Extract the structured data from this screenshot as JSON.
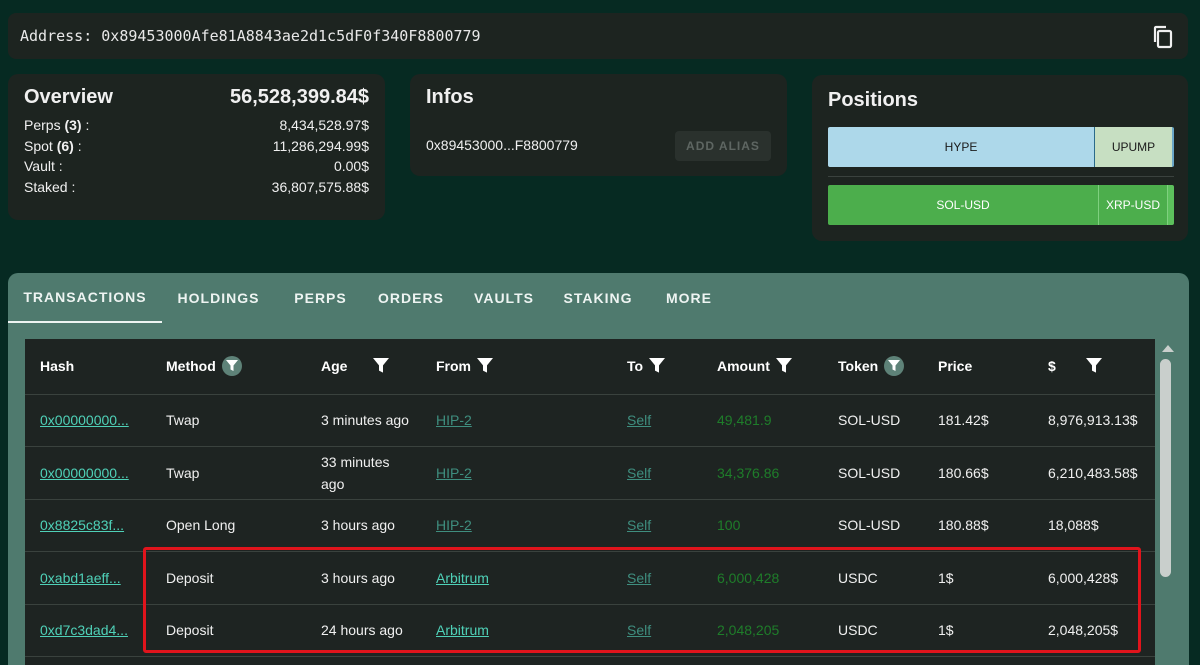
{
  "address_bar": {
    "label": "Address: 0x89453000Afe81A8843ae2d1c5dF0f340F8800779",
    "copy_icon": "copy-icon"
  },
  "overview": {
    "title": "Overview",
    "total": "56,528,399.84$",
    "rows": [
      {
        "label_pre": "Perps ",
        "count": "(3)",
        "label_post": " :",
        "value": "8,434,528.97$"
      },
      {
        "label_pre": "Spot ",
        "count": "(6)",
        "label_post": " :",
        "value": "11,286,294.99$"
      },
      {
        "label_pre": "Vault :",
        "count": "",
        "label_post": "",
        "value": "0.00$"
      },
      {
        "label_pre": "Staked :",
        "count": "",
        "label_post": "",
        "value": "36,807,575.88$"
      }
    ]
  },
  "infos": {
    "title": "Infos",
    "address_short": "0x89453000...F8800779",
    "alias_button": "ADD ALIAS"
  },
  "positions": {
    "title": "Positions",
    "row1": [
      "HYPE",
      "UPUMP"
    ],
    "row2": [
      "SOL-USD",
      "XRP-USD"
    ],
    "colors": {
      "hype": "#add8ea",
      "upump": "#c7dfc2",
      "sol": "#4cae4c",
      "xrp": "#4cae4c"
    }
  },
  "tabs": [
    "TRANSACTIONS",
    "HOLDINGS",
    "PERPS",
    "ORDERS",
    "VAULTS",
    "STAKING",
    "MORE"
  ],
  "table": {
    "headers": [
      "Hash",
      "Method",
      "Age",
      "From",
      "To",
      "Amount",
      "Token",
      "Price",
      "$"
    ],
    "rows": [
      {
        "hash": "0x00000000...",
        "method": "Twap",
        "age": "3 minutes ago",
        "from": "HIP-2",
        "to": "Self",
        "amount": "49,481.9",
        "token": "SOL-USD",
        "price": "181.42$",
        "usd": "8,976,913.13$"
      },
      {
        "hash": "0x00000000...",
        "method": "Twap",
        "age": "33 minutes ago",
        "from": "HIP-2",
        "to": "Self",
        "amount": "34,376.86",
        "token": "SOL-USD",
        "price": "180.66$",
        "usd": "6,210,483.58$"
      },
      {
        "hash": "0x8825c83f...",
        "method": "Open Long",
        "age": "3 hours ago",
        "from": "HIP-2",
        "to": "Self",
        "amount": "100",
        "token": "SOL-USD",
        "price": "180.88$",
        "usd": "18,088$"
      },
      {
        "hash": "0xabd1aeff...",
        "method": "Deposit",
        "age": "3 hours ago",
        "from": "Arbitrum",
        "to": "Self",
        "amount": "6,000,428",
        "token": "USDC",
        "price": "1$",
        "usd": "6,000,428$"
      },
      {
        "hash": "0xd7c3dad4...",
        "method": "Deposit",
        "age": "24 hours ago",
        "from": "Arbitrum",
        "to": "Self",
        "amount": "2,048,205",
        "token": "USDC",
        "price": "1$",
        "usd": "2,048,205$"
      }
    ]
  },
  "colors": {
    "background": "#062a22",
    "card": "#1d2420",
    "panel": "#4f7a6e",
    "link": "#4fd1b8",
    "amount": "#1e7d2a",
    "highlight": "#e0141c"
  }
}
